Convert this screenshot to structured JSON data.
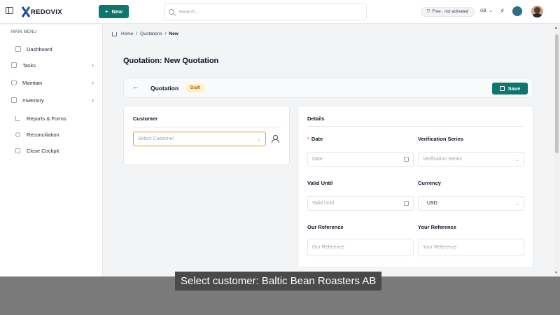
{
  "topbar": {
    "brand": "REDOVIX",
    "new_label": "New",
    "search_placeholder": "Search...",
    "plan_badge": "Free · not activated",
    "language": "GB"
  },
  "sidebar": {
    "heading": "MAIN MENU",
    "items": [
      {
        "label": "Dashboard",
        "icon": "home-icon"
      },
      {
        "label": "Tasks",
        "icon": "checklist-icon"
      },
      {
        "label": "Maintain",
        "icon": "database-icon"
      },
      {
        "label": "Inventory",
        "icon": "box-icon"
      },
      {
        "label": "Reports & Forms",
        "icon": "chart-icon"
      },
      {
        "label": "Reconciliation",
        "icon": "check-circle-icon"
      },
      {
        "label": "Close Cockpit",
        "icon": "clipboard-icon"
      }
    ]
  },
  "breadcrumb": {
    "home": "Home",
    "section": "Quotations",
    "current": "New",
    "separator": "/"
  },
  "page": {
    "title": "Quotation: New Quotation"
  },
  "header": {
    "label": "Quotation",
    "status": "Draft",
    "save_label": "Save"
  },
  "customer_card": {
    "title": "Customer",
    "select_placeholder": "Select Customer"
  },
  "details_card": {
    "title": "Details",
    "date_label": "Date",
    "date_placeholder": "Date",
    "verification_label": "Verification Series",
    "verification_placeholder": "Verification Series",
    "valid_until_label": "Valid Until",
    "valid_until_placeholder": "Valid Until",
    "currency_label": "Currency",
    "currency_value": "USD",
    "our_reference_label": "Our Reference",
    "our_reference_placeholder": "Our Reference",
    "your_reference_label": "Your Reference",
    "your_reference_placeholder": "Your Reference"
  },
  "caption": {
    "text": "Select customer: Baltic Bean Roasters AB"
  },
  "colors": {
    "accent": "#0f766e",
    "draft_bg": "#fef3c7",
    "draft_text": "#b45309",
    "required": "#dc2626"
  }
}
